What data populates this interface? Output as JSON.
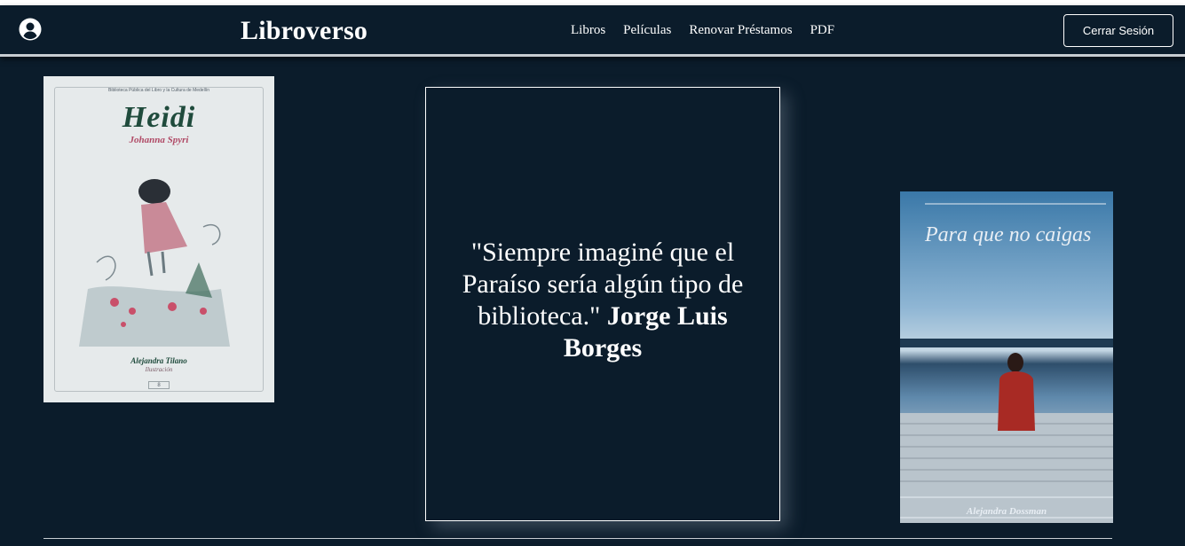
{
  "header": {
    "brand": "Libroverso",
    "nav": [
      "Libros",
      "Películas",
      "Renovar Préstamos",
      "PDF"
    ],
    "logout_label": "Cerrar Sesión",
    "user_icon": "account-circle-icon"
  },
  "quote": {
    "text": "\"Siempre imaginé que el Paraíso sería algún tipo de biblioteca.\"",
    "author": "Jorge Luis Borges"
  },
  "books": {
    "left": {
      "header": "Biblioteca Pública del Libro y la Cultura de Medellín",
      "title": "Heidi",
      "author": "Johanna Spyri",
      "illustrator": "Alejandra Tilano",
      "illustrator_role": "Ilustración",
      "badge": "8"
    },
    "right": {
      "title": "Para que no caigas",
      "author": "Alejandra Dossman"
    }
  },
  "colors": {
    "background": "#0b1c2b",
    "text": "#ffffff",
    "divider": "#c7ccd1"
  }
}
